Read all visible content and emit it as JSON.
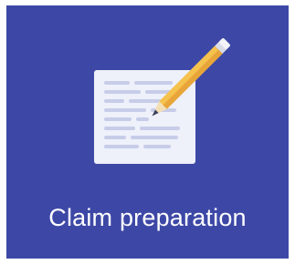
{
  "tile": {
    "label": "Claim preparation",
    "icon": "document-edit-icon",
    "colors": {
      "background": "#3d48a6",
      "paper": "#eef0fa",
      "lines": "#c7cde8",
      "pencil_body": "#f6c24e",
      "pencil_shade": "#e8a53a",
      "eraser_band": "#d9dce8",
      "label": "#ffffff"
    }
  }
}
